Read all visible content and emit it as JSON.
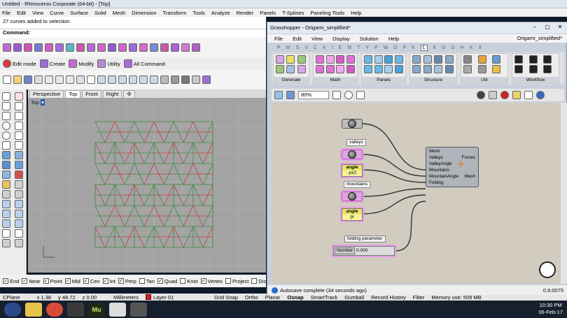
{
  "rhino": {
    "title": "Untitled - Rhinoceros Corporate (64-bit) - [Top]",
    "menu": [
      "File",
      "Edit",
      "View",
      "Curve",
      "Surface",
      "Solid",
      "Mesh",
      "Dimension",
      "Transform",
      "Tools",
      "Analyze",
      "Render",
      "Panels",
      "T-Splines",
      "Paneling Tools",
      "Help"
    ],
    "command_history": "27 curves added to selection.",
    "command_prompt": "Command:",
    "toolbar2": [
      "Edit mode",
      "Create",
      "Modify",
      "Utility",
      "All Command"
    ],
    "viewport_tabs": [
      "Perspective",
      "Top",
      "Front",
      "Right"
    ],
    "viewport_label": "Top",
    "osnaps": [
      {
        "label": "End",
        "checked": true
      },
      {
        "label": "Near",
        "checked": true
      },
      {
        "label": "Point",
        "checked": true
      },
      {
        "label": "Mid",
        "checked": true
      },
      {
        "label": "Cen",
        "checked": true
      },
      {
        "label": "Int",
        "checked": true
      },
      {
        "label": "Perp",
        "checked": true
      },
      {
        "label": "Tan",
        "checked": false
      },
      {
        "label": "Quad",
        "checked": true
      },
      {
        "label": "Knot",
        "checked": false
      },
      {
        "label": "Vertex",
        "checked": true
      },
      {
        "label": "Project",
        "checked": false
      },
      {
        "label": "Disable",
        "checked": false
      }
    ],
    "status": {
      "cplane": "CPlane",
      "x": "x 1.38",
      "y": "y 48.72",
      "z": "z 0.00",
      "units": "Millimeters",
      "layer": "Layer 01",
      "toggles": [
        "Grid Snap",
        "Ortho",
        "Planar",
        "Osnap",
        "SmartTrack",
        "Gumball",
        "Record History",
        "Filter",
        "Memory use: 509 MB"
      ]
    },
    "layer_color": "#cc2222"
  },
  "grasshopper": {
    "title": "Grasshopper - Origami_simplified*",
    "document": "Origami_simplified*",
    "menu": [
      "File",
      "Edit",
      "View",
      "Display",
      "Solution",
      "Help"
    ],
    "categories": [
      "P",
      "M",
      "S",
      "V",
      "C",
      "X",
      "I",
      "E",
      "M",
      "T",
      "Y",
      "P",
      "W",
      "D",
      "P",
      "K",
      "L",
      "K",
      "G",
      "D",
      "H",
      "K",
      "X"
    ],
    "active_category_index": 16,
    "panels": [
      "Generate",
      "Math",
      "Panels",
      "Structure",
      "Util",
      "Workflow"
    ],
    "zoom": "80%",
    "status_text": "Autosave complete (34 seconds ago)",
    "version": "0.9.0075",
    "components": {
      "valleys_tag": "valleys",
      "mountains_tag": "mountains",
      "angle1_title": "angle",
      "angle1_value": "-pi/2",
      "angle2_title": "angle",
      "angle2_value": "pi",
      "folding_tag": "folding parameter",
      "slider_label": "Number",
      "slider_value": "0.000",
      "main_inputs": [
        "Mesh",
        "Valleys",
        "ValleyAngle",
        "Mountains",
        "MountainAngle",
        "Folding"
      ],
      "main_outputs": [
        "Forces",
        "Mesh"
      ]
    }
  },
  "taskbar": {
    "time": "10:30 PM",
    "date": "06-Feb-17",
    "apps": [
      "Start",
      "Explorer",
      "Chrome",
      "Media",
      "Muse",
      "Rhino",
      "Grasshopper"
    ]
  },
  "colors": {
    "mesh_green": "#3a8a3a",
    "mesh_red": "#c83a3a",
    "selection_pink": "#e79de7"
  }
}
